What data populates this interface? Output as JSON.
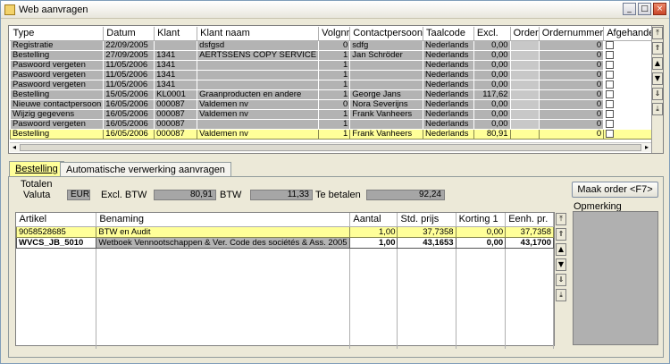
{
  "window": {
    "title": "Web aanvragen"
  },
  "top_grid": {
    "headers": [
      "Type",
      "Datum",
      "Klant",
      "Klant naam",
      "Volgnr",
      "Contactpersoon",
      "Taalcode",
      "Excl.",
      "Order",
      "Ordernummer",
      "Afgehandeld"
    ],
    "rows": [
      [
        "Registratie",
        "22/09/2005",
        "",
        "dsfgsd",
        "0",
        "sdfg",
        "Nederlands",
        "0,00",
        "",
        "0",
        ""
      ],
      [
        "Bestelling",
        "27/09/2005",
        "1341",
        "AERTSSENS COPY SERVICE",
        "1",
        "Jan Schröder",
        "Nederlands",
        "0,00",
        "",
        "0",
        ""
      ],
      [
        "Paswoord vergeten",
        "11/05/2006",
        "1341",
        "",
        "1",
        "",
        "Nederlands",
        "0,00",
        "",
        "0",
        ""
      ],
      [
        "Paswoord vergeten",
        "11/05/2006",
        "1341",
        "",
        "1",
        "",
        "Nederlands",
        "0,00",
        "",
        "0",
        ""
      ],
      [
        "Paswoord vergeten",
        "11/05/2006",
        "1341",
        "",
        "1",
        "",
        "Nederlands",
        "0,00",
        "",
        "0",
        ""
      ],
      [
        "Bestelling",
        "15/05/2006",
        "KL0001",
        "Graanproducten en andere",
        "1",
        "George Jans",
        "Nederlands",
        "117,62",
        "",
        "0",
        ""
      ],
      [
        "Nieuwe contactpersoon",
        "16/05/2006",
        "000087",
        "Valdemen nv",
        "0",
        "Nora Severijns",
        "Nederlands",
        "0,00",
        "",
        "0",
        ""
      ],
      [
        "Wijzig gegevens",
        "16/05/2006",
        "000087",
        "Valdemen nv",
        "1",
        "Frank Vanheers",
        "Nederlands",
        "0,00",
        "",
        "0",
        ""
      ],
      [
        "Paswoord vergeten",
        "16/05/2006",
        "000087",
        "",
        "1",
        "",
        "Nederlands",
        "0,00",
        "",
        "0",
        ""
      ],
      [
        "Bestelling",
        "16/05/2006",
        "000087",
        "Valdemen nv",
        "1",
        "Frank Vanheers",
        "Nederlands",
        "80,91",
        "",
        "0",
        ""
      ]
    ],
    "selected_row": 9
  },
  "tabs": [
    "Bestelling",
    "Automatische verwerking aanvragen"
  ],
  "totals": {
    "section_label": "Totalen",
    "valuta_label": "Valuta",
    "valuta": "EUR",
    "excl_label": "Excl. BTW",
    "excl": "80,91",
    "btw_label": "BTW",
    "btw": "11,33",
    "te_betalen_label": "Te betalen",
    "te_betalen": "92,24"
  },
  "maak_order_label": "Maak order <F7>",
  "opmerking_label": "Opmerking",
  "bottom_grid": {
    "headers": [
      "Artikel",
      "Benaming",
      "Aantal",
      "Std. prijs",
      "Korting 1",
      "Eenh. pr."
    ],
    "rows": [
      [
        "9058528685",
        "BTW en Audit",
        "1,00",
        "37,7358",
        "0,00",
        "37,7358"
      ],
      [
        "WVCS_JB_5010",
        "Wetboek Vennootschappen & Ver. Code des sociétés & Ass. 2005",
        "1,00",
        "43,1653",
        "0,00",
        "43,1700"
      ]
    ]
  }
}
